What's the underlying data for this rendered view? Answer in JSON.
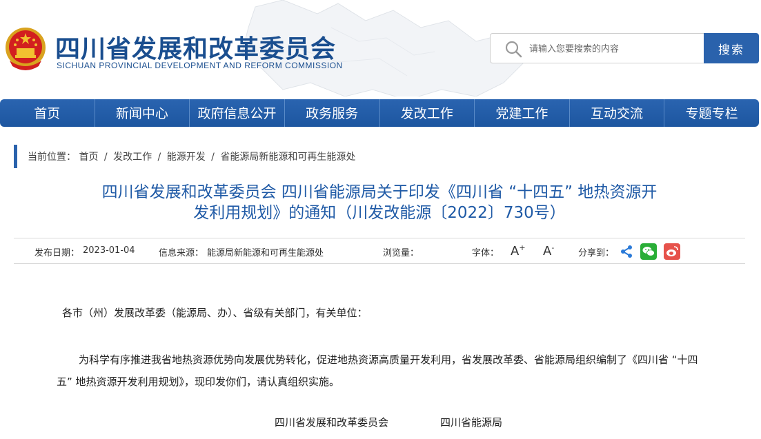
{
  "header": {
    "title": "四川省发展和改革委员会",
    "subtitle": "SICHUAN PROVINCIAL DEVELOPMENT AND REFORM COMMISSION"
  },
  "search": {
    "placeholder": "请输入您要搜索的内容",
    "button_label": "搜索"
  },
  "nav": {
    "items": [
      "首页",
      "新闻中心",
      "政府信息公开",
      "政务服务",
      "发改工作",
      "党建工作",
      "互动交流",
      "专题专栏"
    ]
  },
  "breadcrumb": {
    "prefix": "当前位置：",
    "items": [
      "首页",
      "发改工作",
      "能源开发",
      "省能源局新能源和可再生能源处"
    ],
    "separator": "/"
  },
  "article": {
    "title_line1": "四川省发展和改革委员会 四川省能源局关于印发《四川省 “十四五” 地热资源开",
    "title_line2": "发利用规划》的通知（川发改能源〔2022〕730号）"
  },
  "meta": {
    "date_label": "发布日期：",
    "date": "2023-01-04",
    "source_label": "信息来源：",
    "source": "能源局新能源和可再生能源处",
    "views_label": "浏览量：",
    "font_label": "字体：",
    "font_larger": "A",
    "font_smaller": "A",
    "share_label": "分享到："
  },
  "body": {
    "salutation": "各市（州）发展改革委（能源局、办）、省级有关部门，有关单位：",
    "paragraph": "为科学有序推进我省地热资源优势向发展优势转化，促进地热资源高质量开发利用，省发展改革委、省能源局组织编制了《四川省 “十四五” 地热资源开发利用规划》，现印发你们，请认真组织实施。",
    "signature_1": "四川省发展和改革委员会",
    "signature_2": "四川省能源局"
  },
  "colors": {
    "brand_blue": "#1a4e8f",
    "nav_blue": "#2a62ac",
    "title_blue": "#1f5aa6",
    "wechat_green": "#2aae37",
    "weibo_red": "#e6524b"
  },
  "icons": [
    "national-emblem-icon",
    "search-icon",
    "share-icon",
    "wechat-icon",
    "weibo-icon"
  ]
}
